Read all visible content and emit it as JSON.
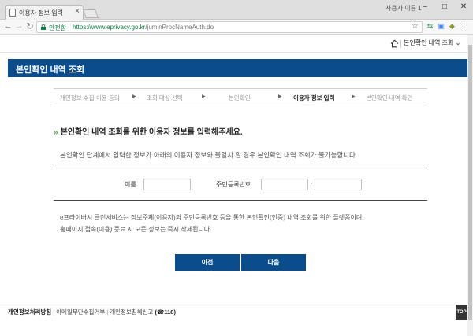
{
  "browser": {
    "tab_title": "이용자 정보 입력",
    "window_user": "사용자 이름 1",
    "secure_label": "안전함",
    "url_origin": "https://www.eprivacy.go.kr",
    "url_path": "/juminProcNameAuth.do"
  },
  "util": {
    "selected_option": "본인확인 내역 조회"
  },
  "banner": {
    "title": "본인확인 내역 조회"
  },
  "steps": [
    {
      "label": "개인정보 수집·이용 등의",
      "active": false
    },
    {
      "label": "조회 대상 선택",
      "active": false
    },
    {
      "label": "본인확인",
      "active": false
    },
    {
      "label": "이용자 정보 입력",
      "active": true
    },
    {
      "label": "본인확인 내역 확인",
      "active": false
    }
  ],
  "main": {
    "headline": "본인확인 내역 조회를 위한 이용자 정보를 입력해주세요.",
    "description": "본인확인 단계에서 입력한 정보가 아래의 이용자 정보와 불일치 할 경우 본인확인 내역 조회가 불가능합니다.",
    "name_label": "이름",
    "name_value": "",
    "rrn_label": "주민등록번호",
    "rrn_first_value": "",
    "rrn_second_value": "",
    "rrn_separator": "-",
    "notice_line1": "e프라이버시 클린서비스는 정보주체(이용자)의 주민등록번호 등을 통한 본인확인(인증) 내역 조회를 위한 플랫폼이며,",
    "notice_line2": "홈페이지 접속(이용) 종료 시 모든 정보는 즉시 삭제됩니다.",
    "prev_button": "이전",
    "next_button": "다음"
  },
  "footer": {
    "privacy_policy": "개인정보처리방침",
    "email_refusal": "이메일무단수집거부",
    "report_link": "개인정보침해신고",
    "report_phone": "(☎118)",
    "top_button": "TOP"
  },
  "colors": {
    "brand_blue": "#0b4c8c",
    "secure_green": "#0b8043",
    "chevron_green": "#4cae4c"
  }
}
